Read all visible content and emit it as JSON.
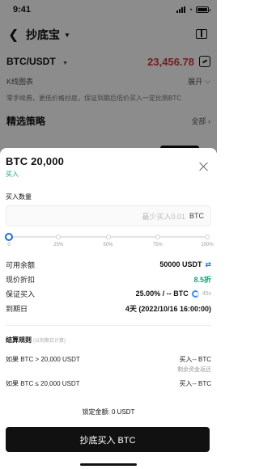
{
  "status_bar": {
    "time": "9:41"
  },
  "nav": {
    "title": "抄底宝",
    "book_icon": "book-icon"
  },
  "pair": {
    "name": "BTC/USDT",
    "price": "23,456.78"
  },
  "kline": {
    "label": "K线图表",
    "toggle": "展开"
  },
  "description": "零手续费，更低价格抄底，保证到期后低价买入一定比例BTC",
  "strategy": {
    "title": "精选策略",
    "all": "全部"
  },
  "sheet": {
    "title": "BTC 20,000",
    "subtitle": "买入",
    "amount_label": "买入数量",
    "input_placeholder": "最少买入0.01",
    "input_unit": "BTC",
    "slider": {
      "value_percent": 0,
      "marks": [
        "0",
        "25%",
        "50%",
        "75%",
        "100%"
      ]
    },
    "info": [
      {
        "label": "可用余额",
        "value": "50000 USDT"
      },
      {
        "label": "现价折扣",
        "value": "8.5折"
      },
      {
        "label": "保证买入",
        "value": "25.00% / -- BTC",
        "extra": "45s"
      },
      {
        "label": "到期日",
        "value": "4天 (2022/10/16 16:00:00)"
      }
    ],
    "rules": {
      "title": "结算规则",
      "note": "(以到期日计算)",
      "items": [
        {
          "condition": "如果 BTC > 20,000 USDT",
          "result": "买入-- BTC",
          "note": "剩余资金返还"
        },
        {
          "condition": "如果 BTC ≤ 20,000 USDT",
          "result": "买入-- BTC"
        }
      ]
    },
    "lock_text": "锁定金额:  0 USDT",
    "buy_button": "抄底买入 BTC"
  },
  "colors": {
    "price_red": "#d63737",
    "accent_green": "#18a37a",
    "accent_blue": "#1c6fd9"
  }
}
